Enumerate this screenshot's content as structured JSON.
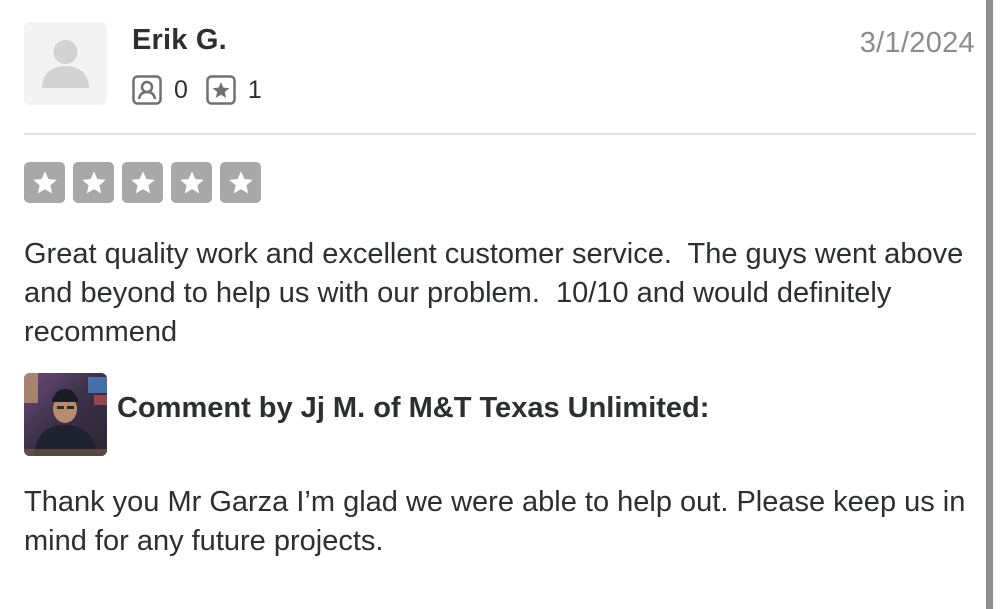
{
  "review": {
    "user_name": "Erik G.",
    "friends_count": "0",
    "reviews_count": "1",
    "date": "3/1/2024",
    "rating": 5,
    "text": "Great quality work and excellent customer service.  The guys went above and beyond to help us with our problem.  10/10 and would definitely recommend"
  },
  "owner_comment": {
    "heading": "Comment by Jj M. of M&T Texas Unlimited:",
    "text": "Thank you Mr Garza I’m glad we were able to help out. Please keep us in mind for any future projects."
  },
  "colors": {
    "star_inactive": "#a8a8a8",
    "text": "#2d2e2f",
    "muted": "#8c8c8c",
    "divider": "#e3e3e3"
  },
  "icons": {
    "avatar": "default-user-icon",
    "friends": "friends-icon",
    "reviews": "review-star-icon",
    "star": "star-icon"
  }
}
